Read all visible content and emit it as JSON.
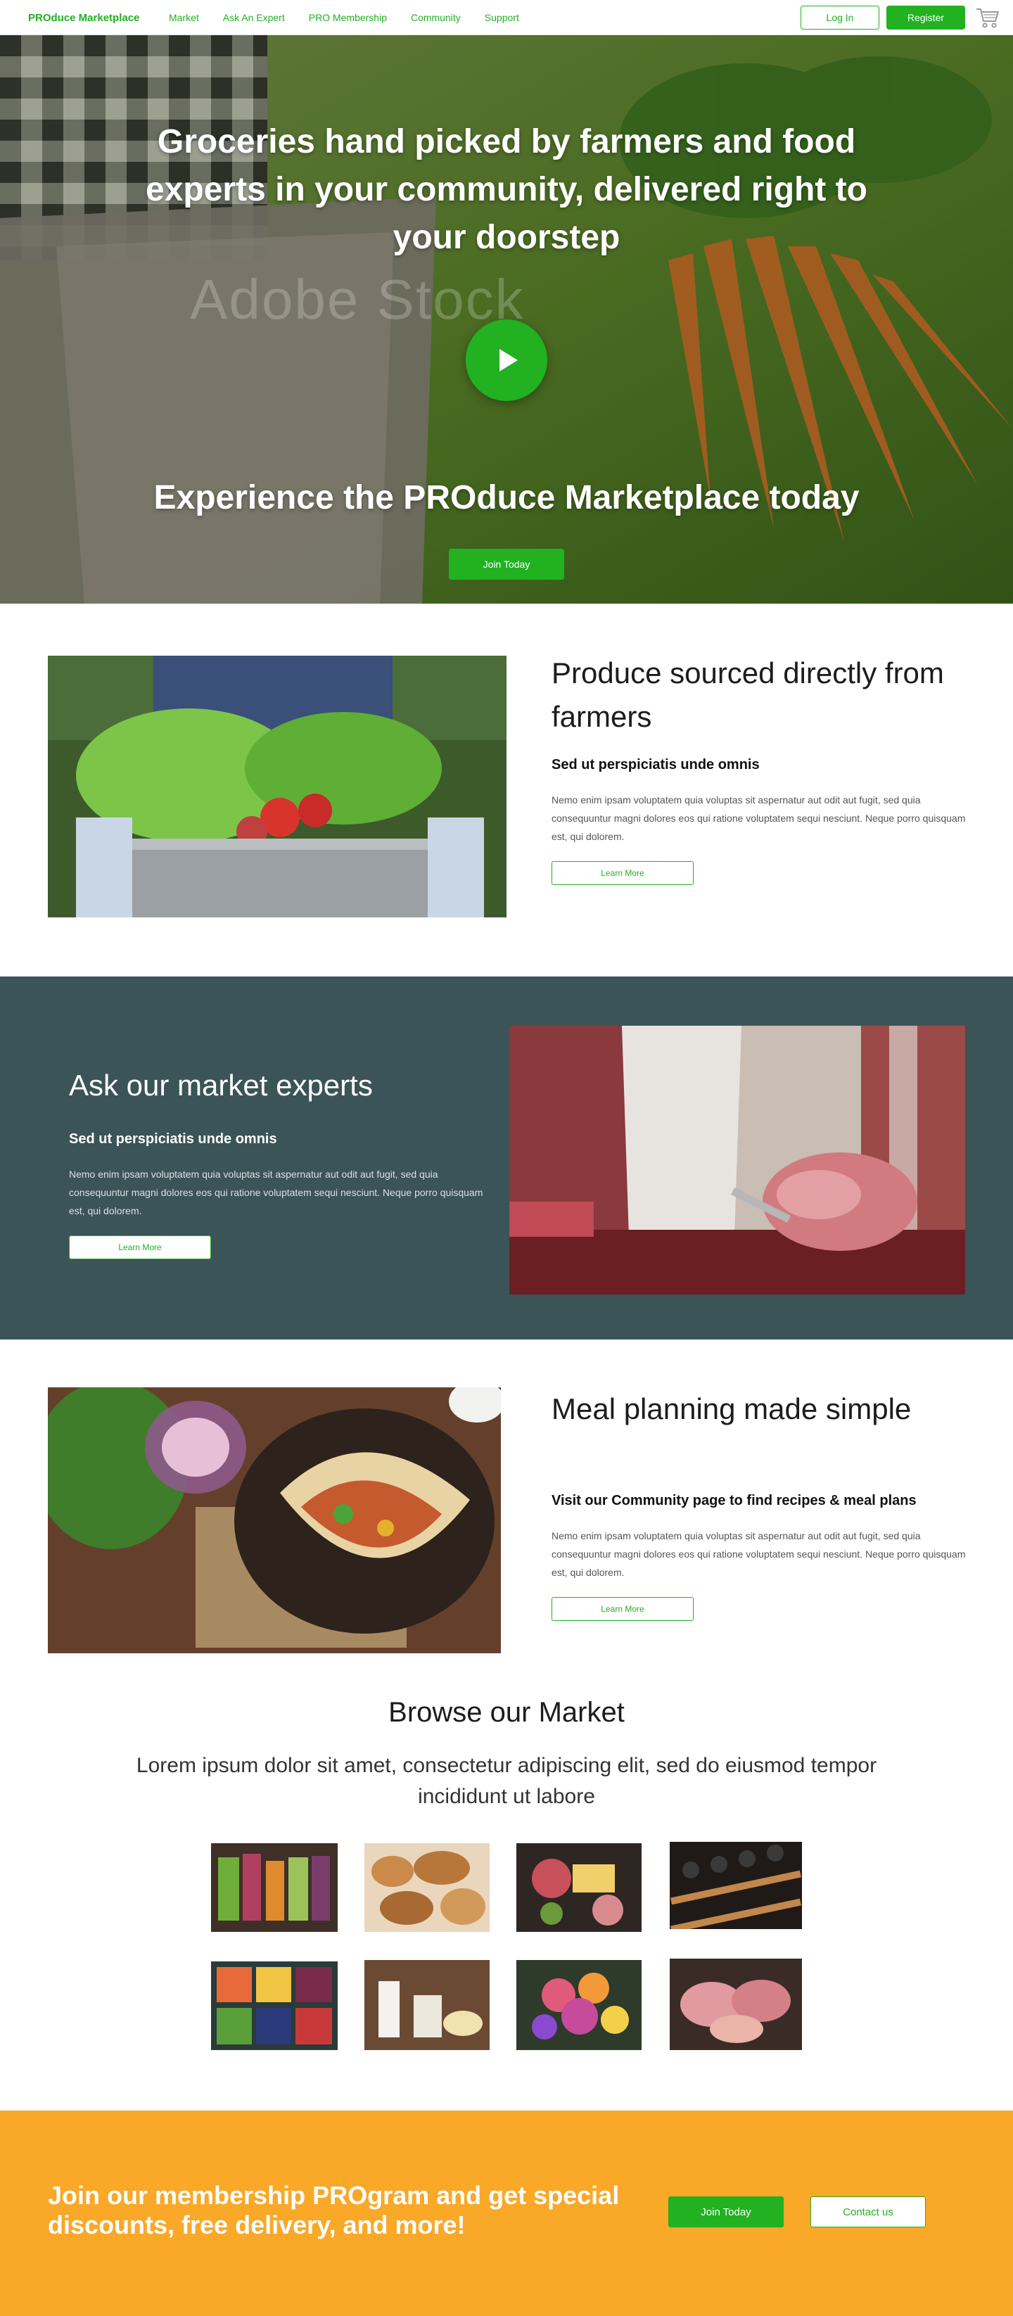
{
  "nav": {
    "brand": "PROduce Marketplace",
    "links": [
      "Market",
      "Ask An Expert",
      "PRO Membership",
      "Community",
      "Support"
    ],
    "login": "Log In",
    "register": "Register",
    "cart_icon": "cart-icon"
  },
  "hero": {
    "title": "Groceries hand picked by farmers and food experts in your community, delivered right to your doorstep",
    "subtitle": "Experience the PROduce Marketplace today",
    "cta": "Join Today",
    "play_icon": "play-icon"
  },
  "features": [
    {
      "title": "Produce sourced directly from farmers",
      "subtitle": "Sed ut perspiciatis unde omnis",
      "body": "Nemo enim ipsam voluptatem quia voluptas sit aspernatur aut odit aut fugit, sed quia consequuntur magni dolores eos qui ratione voluptatem sequi nesciunt. Neque porro quisquam est, qui dolorem.",
      "button": "Learn More"
    },
    {
      "title": "Ask our market experts",
      "subtitle": "Sed ut perspiciatis unde omnis",
      "body": "Nemo enim ipsam voluptatem quia voluptas sit aspernatur aut odit aut fugit, sed quia consequuntur magni dolores eos qui ratione voluptatem sequi nesciunt. Neque porro quisquam est, qui dolorem.",
      "button": "Learn More"
    },
    {
      "title": "Meal planning made simple",
      "subtitle": "Visit our Community page to find recipes & meal plans",
      "body": "Nemo enim ipsam voluptatem quia voluptas sit aspernatur aut odit aut fugit, sed quia consequuntur magni dolores eos qui ratione voluptatem sequi nesciunt. Neque porro quisquam est, qui dolorem.",
      "button": "Learn More"
    }
  ],
  "browse": {
    "title": "Browse our Market",
    "subtitle": "Lorem ipsum dolor sit amet, consectetur adipiscing elit, sed do eiusmod tempor incididunt ut labore"
  },
  "membership": {
    "text": "Join our membership PROgram and get special discounts, free delivery, and more!",
    "join": "Join Today",
    "contact": "Contact us"
  },
  "colors": {
    "accent": "#21b121",
    "dark_band": "#3b5458",
    "membership_bg": "#f9a828"
  }
}
